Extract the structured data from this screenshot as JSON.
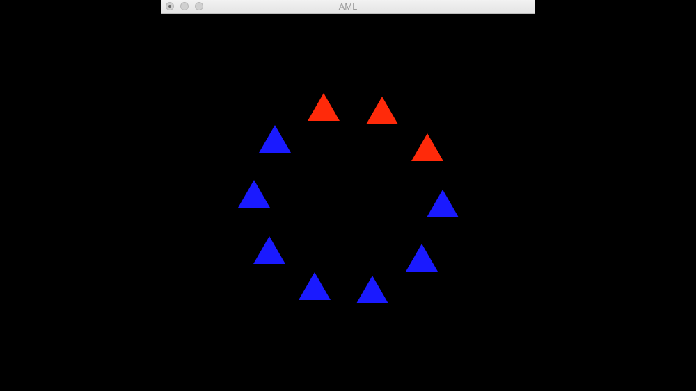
{
  "window": {
    "title": "AML"
  },
  "scene": {
    "background": "#000000",
    "colors": {
      "red": "#ff2a0a",
      "blue": "#1a1aff"
    },
    "triangles": [
      {
        "color": "red"
      },
      {
        "color": "red"
      },
      {
        "color": "red"
      },
      {
        "color": "blue"
      },
      {
        "color": "blue"
      },
      {
        "color": "blue"
      },
      {
        "color": "blue"
      },
      {
        "color": "blue"
      },
      {
        "color": "blue"
      },
      {
        "color": "blue"
      }
    ]
  }
}
